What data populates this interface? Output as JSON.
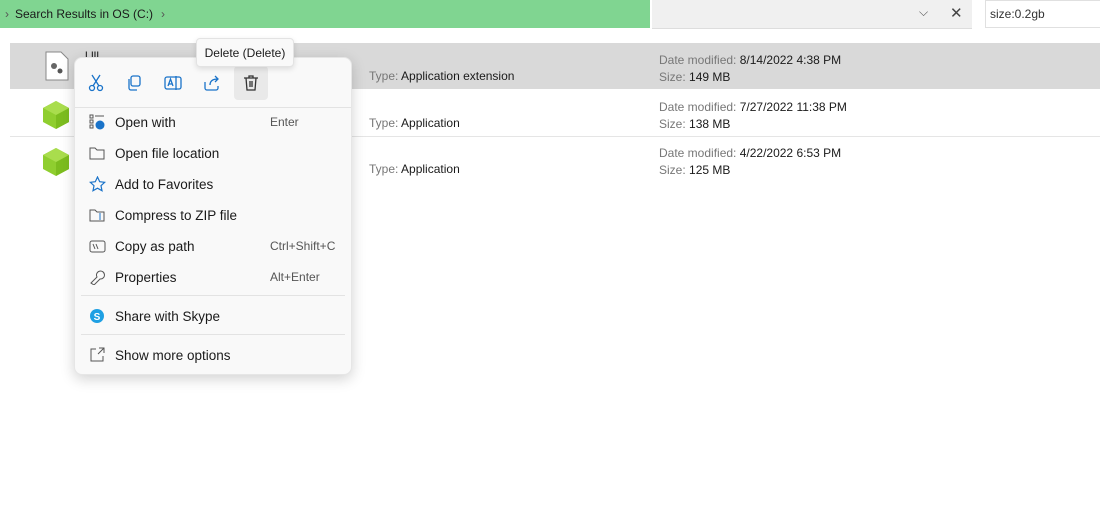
{
  "breadcrumb": {
    "location": "Search Results in OS (C:)"
  },
  "search": {
    "value": "size:0.2gb"
  },
  "files": [
    {
      "name_fragment": "l       lll",
      "trail": "..",
      "type_label": "Type:",
      "type": "Application extension",
      "date_label": "Date modified:",
      "date": "8/14/2022 4:38 PM",
      "size_label": "Size:",
      "size": "149 MB",
      "icon": "settings-file-icon",
      "selected": true
    },
    {
      "trail": "..",
      "type_label": "Type:",
      "type": "Application",
      "date_label": "Date modified:",
      "date": "7/27/2022 11:38 PM",
      "size_label": "Size:",
      "size": "138 MB",
      "icon": "green-cube-icon"
    },
    {
      "type_label": "Type:",
      "type": "Application",
      "date_label": "Date modified:",
      "date": "4/22/2022 6:53 PM",
      "size_label": "Size:",
      "size": "125 MB",
      "icon": "green-cube-icon"
    }
  ],
  "context_menu": {
    "toolbar": [
      "cut-icon",
      "copy-icon",
      "rename-icon",
      "share-icon",
      "delete-icon"
    ],
    "tooltip": "Delete (Delete)",
    "items": [
      {
        "label": "Open with",
        "shortcut": "Enter"
      },
      {
        "label": "Open file location",
        "shortcut": ""
      },
      {
        "label": "Add to Favorites",
        "shortcut": ""
      },
      {
        "label": "Compress to ZIP file",
        "shortcut": ""
      },
      {
        "label": "Copy as path",
        "shortcut": "Ctrl+Shift+C"
      },
      {
        "label": "Properties",
        "shortcut": "Alt+Enter"
      },
      {
        "label": "Share with Skype",
        "shortcut": ""
      },
      {
        "label": "Show more options",
        "shortcut": ""
      }
    ]
  },
  "colors": {
    "breadcrumb_bg": "#80d591",
    "accent": "#1a73c9",
    "selected_row": "#d9d9d9"
  }
}
